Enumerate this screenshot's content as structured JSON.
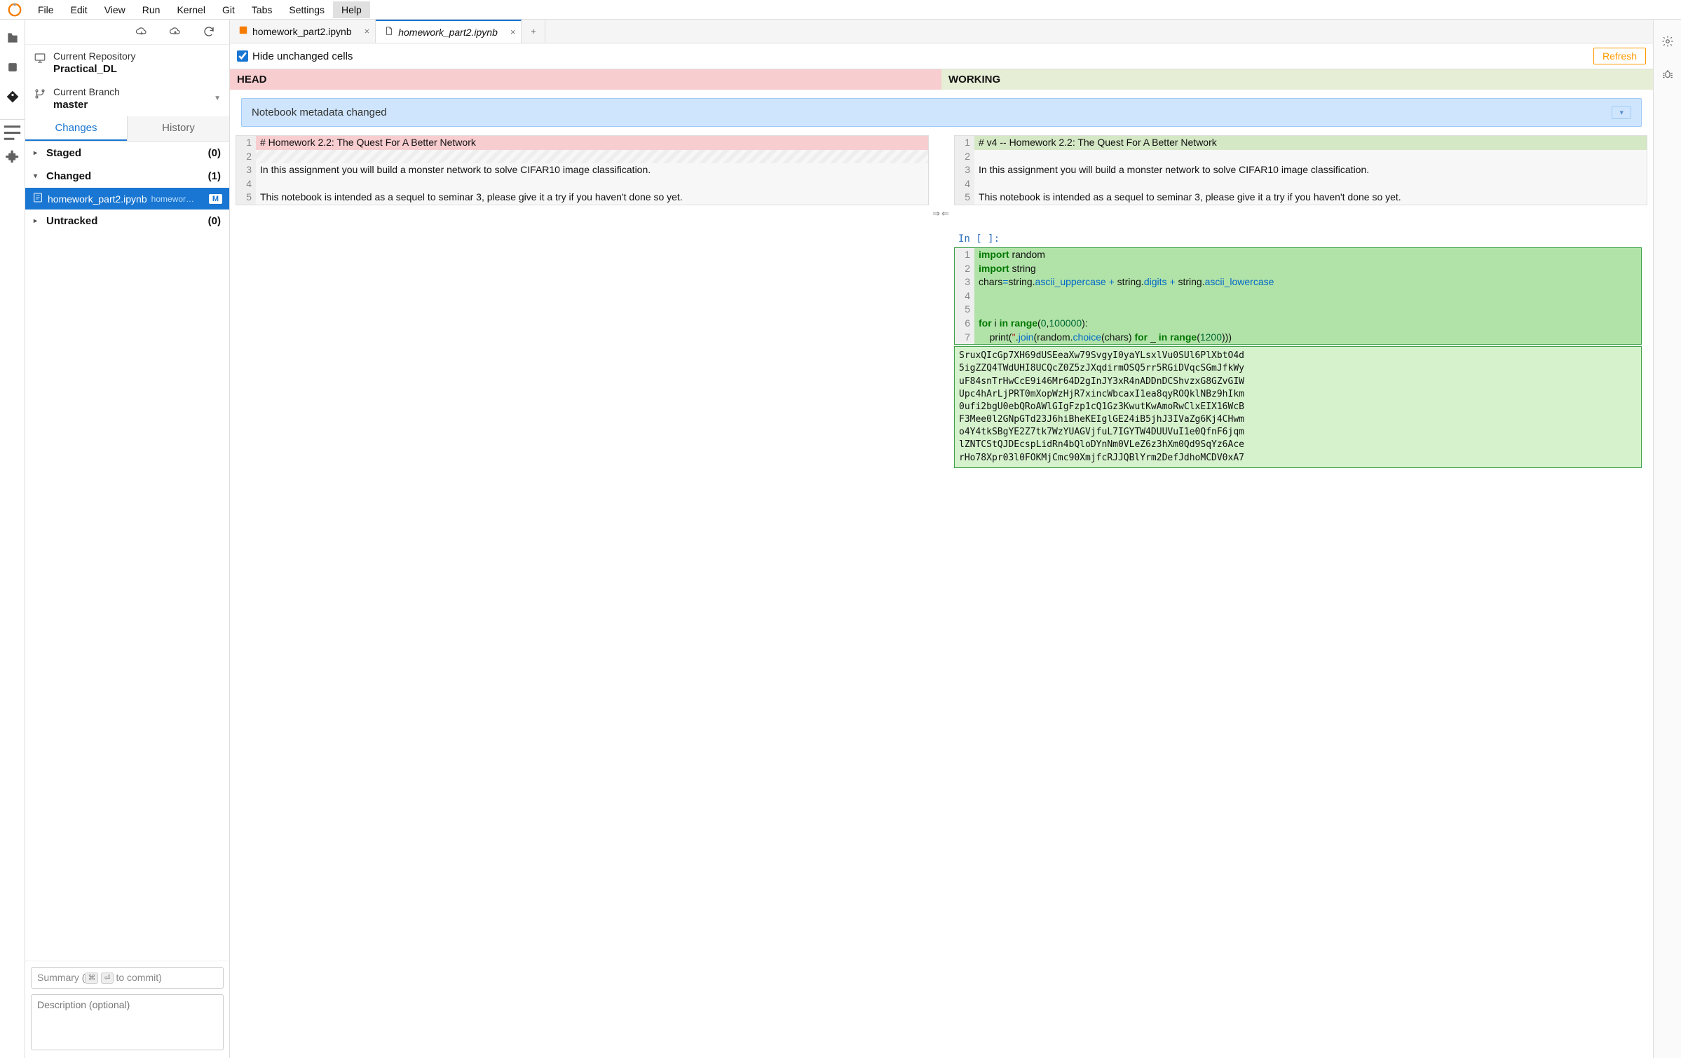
{
  "menubar": {
    "items": [
      "File",
      "Edit",
      "View",
      "Run",
      "Kernel",
      "Git",
      "Tabs",
      "Settings",
      "Help"
    ],
    "active_index": 8
  },
  "sidebar": {
    "repo": {
      "label": "Current Repository",
      "value": "Practical_DL"
    },
    "branch": {
      "label": "Current Branch",
      "value": "master"
    },
    "tabs": {
      "changes": "Changes",
      "history": "History",
      "active": "changes"
    },
    "groups": {
      "staged": {
        "label": "Staged",
        "count": "(0)",
        "expanded": true
      },
      "changed": {
        "label": "Changed",
        "count": "(1)",
        "expanded": true
      },
      "untracked": {
        "label": "Untracked",
        "count": "(0)",
        "expanded": false
      }
    },
    "changed_file": {
      "name": "homework_part2.ipynb",
      "path": "homewor…",
      "badge": "M"
    },
    "commit": {
      "summary_placeholder": "Summary (⌘ ⏎ to commit)",
      "desc_placeholder": "Description (optional)"
    }
  },
  "tabs": [
    {
      "label": "homework_part2.ipynb",
      "italic": false,
      "icon": "nb"
    },
    {
      "label": "homework_part2.ipynb",
      "italic": true,
      "icon": "file"
    }
  ],
  "tabs_active_index": 1,
  "diff": {
    "hide_unchanged_label": "Hide unchanged cells",
    "hide_unchanged_checked": true,
    "refresh_label": "Refresh",
    "head_left": "HEAD",
    "head_right": "WORKING",
    "meta_banner": "Notebook metadata changed",
    "left_lines": [
      {
        "n": "1",
        "cls": "line-del",
        "text": "# Homework 2.2: The Quest For A Better Network"
      },
      {
        "n": "2",
        "cls": "line-hatch",
        "text": " "
      },
      {
        "n": "",
        "cls": "",
        "text": ""
      },
      {
        "n": "3",
        "cls": "",
        "text": "In this assignment you will build a monster network to solve CIFAR10 image classification."
      },
      {
        "n": "4",
        "cls": "",
        "text": ""
      },
      {
        "n": "5",
        "cls": "",
        "text": "This notebook is intended as a sequel to seminar 3, please give it a try if you haven't done so yet."
      }
    ],
    "right_lines": [
      {
        "n": "1",
        "cls": "line-add",
        "text": "# v4 -- Homework 2.2: The Quest For A Better Network"
      },
      {
        "n": "2",
        "cls": "",
        "text": ""
      },
      {
        "n": "3",
        "cls": "",
        "text": "In this assignment you will build a monster network to solve CIFAR10 image classification."
      },
      {
        "n": "4",
        "cls": "",
        "text": ""
      },
      {
        "n": "5",
        "cls": "",
        "text": "This notebook is intended as a sequel to seminar 3, please give it a try if you haven't done so yet."
      }
    ],
    "merge_arrows": "⇒⇐"
  },
  "added_cell": {
    "prompt": "In [ ]:",
    "code_lines": [
      {
        "n": "1",
        "html": "<span class='kw'>import</span> random"
      },
      {
        "n": "2",
        "html": "<span class='kw'>import</span> string"
      },
      {
        "n": "3",
        "html": "chars<span class='kw2'>=</span>string.<span class='kw2'>ascii_uppercase</span> <span class='kw2'>+</span> string.<span class='kw2'>digits</span> <span class='kw2'>+</span> string.<span class='kw2'>ascii_lowercase</span>"
      },
      {
        "n": "4",
        "html": ""
      },
      {
        "n": "5",
        "html": ""
      },
      {
        "n": "6",
        "html": "<span class='kw'>for</span> i <span class='kw'>in</span> <span class='kw'>range</span>(<span class='num'>0</span>,<span class='num'>100000</span>):"
      },
      {
        "n": "7",
        "html": "    print(<span class='str'>''</span>.<span class='kw2'>join</span>(random.<span class='kw2'>choice</span>(chars) <span class='kw'>for</span> _ <span class='kw'>in</span> <span class='kw'>range</span>(<span class='num'>1200</span>)))"
      }
    ],
    "output": "SruxQIcGp7XH69dUSEeaXw79SvgyI0yaYLsxlVu0SUl6PlXbtO4d\n5igZZQ4TWdUHI8UCQcZ0Z5zJXqdirmOSQ5rr5RGiDVqcSGmJfkWy\nuF84snTrHwCcE9i46Mr64D2gInJY3xR4nADDnDCShvzxG8GZvGIW\nUpc4hArLjPRT0mXopWzHjR7xincWbcaxI1ea8qyROQklNBz9hIkm\n0ufi2bgU0ebQRoAWlGIgFzp1cQ1Gz3KwutKwAmoRwClxEIX16WcB\nF3Mee0l2GNpGTd23J6hiBheKEIglGE24iB5jhJ3IVaZg6Kj4CHwm\no4Y4tkSBgYE2Z7tk7WzYUAGVjfuL7IGYTW4DUUVuI1e0QfnF6jqm\nlZNTCStQJDEcspLidRn4bQloDYnNm0VLeZ6z3hXm0Qd9SqYz6Ace\nrHo78Xpr03l0FOKMjCmc90XmjfcRJJQBlYrm2DefJdhoMCDV0xA7"
  }
}
